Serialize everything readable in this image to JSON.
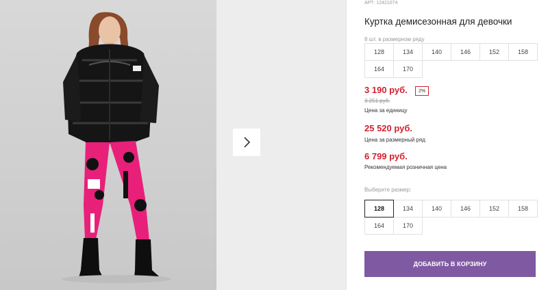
{
  "product": {
    "article": "АРТ: 12421074",
    "title": "Куртка демисезонная для девочки",
    "pack_note": "8 шт. в размерном ряду",
    "pack_sizes": [
      "128",
      "134",
      "140",
      "146",
      "152",
      "158",
      "164",
      "170"
    ],
    "pricing": {
      "unit_price": "3 190 руб.",
      "discount": "2%",
      "old_price": "3 251 руб.",
      "unit_label": "Цена за единицу",
      "pack_price": "25 520 руб.",
      "pack_label": "Цена за размерный ряд",
      "retail_price": "6 799 руб.",
      "retail_label": "Рекомендуемая розничная цена"
    },
    "size_select": {
      "label": "Выберите размер:",
      "options": [
        "128",
        "134",
        "140",
        "146",
        "152",
        "158",
        "164",
        "170"
      ],
      "selected": "128"
    },
    "add_to_cart": "ДОБАВИТЬ В КОРЗИНУ"
  },
  "gallery": {
    "next_icon": "chevron-right-icon"
  },
  "colors": {
    "price_red": "#d3202e",
    "button_purple": "#7f5aa3"
  }
}
